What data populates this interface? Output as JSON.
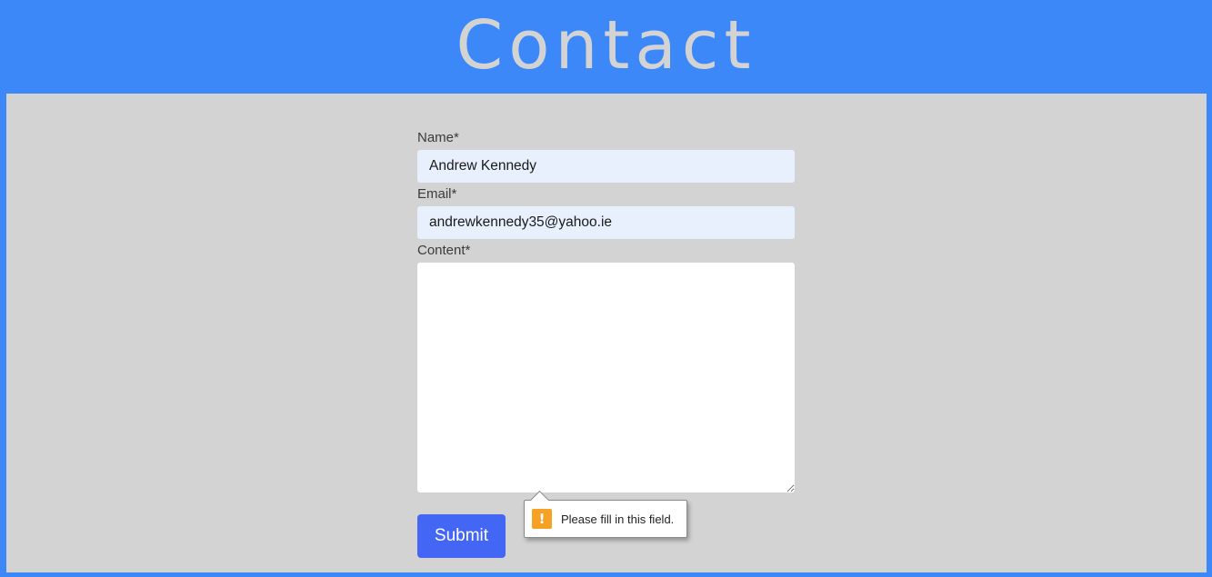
{
  "header": {
    "title": "Contact"
  },
  "form": {
    "name_label": "Name*",
    "name_value": "Andrew Kennedy",
    "email_label": "Email*",
    "email_value": "andrewkennedy35@yahoo.ie",
    "content_label": "Content*",
    "content_value": "",
    "submit_label": "Submit"
  },
  "validation": {
    "message": "Please fill in this field.",
    "icon": "warning-icon",
    "icon_glyph": "!"
  },
  "colors": {
    "background": "#3d88f8",
    "panel": "#d3d3d3",
    "title": "#d3d3d3",
    "submit": "#4466f5",
    "autofill": "#e8f0fe",
    "warning": "#f4a124"
  }
}
